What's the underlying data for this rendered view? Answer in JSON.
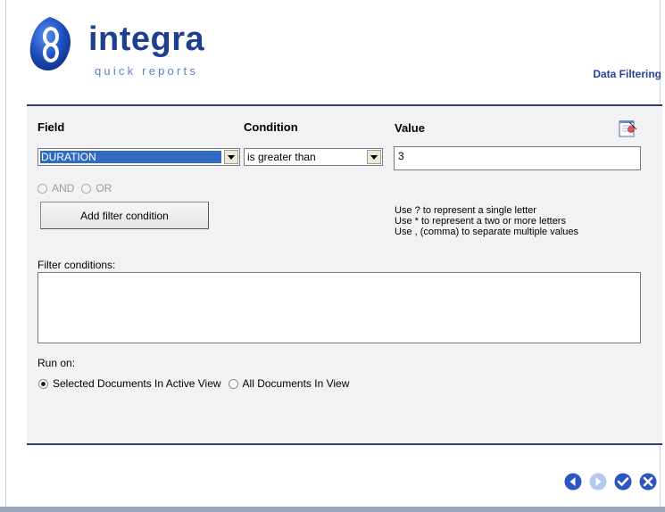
{
  "app": {
    "logo_text": "integra",
    "logo_subtext": "quick reports",
    "page_title": "Data Filtering"
  },
  "filter": {
    "field_heading": "Field",
    "condition_heading": "Condition",
    "value_heading": "Value",
    "field_selected": "DURATION",
    "condition_selected": "is greater than",
    "value": "3",
    "and_label": "AND",
    "or_label": "OR",
    "add_button": "Add filter condition",
    "hints": [
      "Use ? to represent a single letter",
      "Use * to represent a two or more letters",
      "Use , (comma) to separate multiple values"
    ],
    "conditions_label": "Filter conditions:"
  },
  "run_on": {
    "label": "Run on:",
    "options": [
      {
        "label": "Selected Documents In Active View",
        "checked": true
      },
      {
        "label": "All Documents In View",
        "checked": false
      }
    ]
  },
  "icons": {
    "notepad": "notepad-icon",
    "back": "back-arrow-icon",
    "forward": "forward-arrow-icon",
    "ok": "check-icon",
    "cancel": "close-icon"
  },
  "colors": {
    "brand": "#1e3f8f",
    "accent": "#29409c",
    "selection": "#316ac5",
    "panel": "#f2f2f4"
  }
}
